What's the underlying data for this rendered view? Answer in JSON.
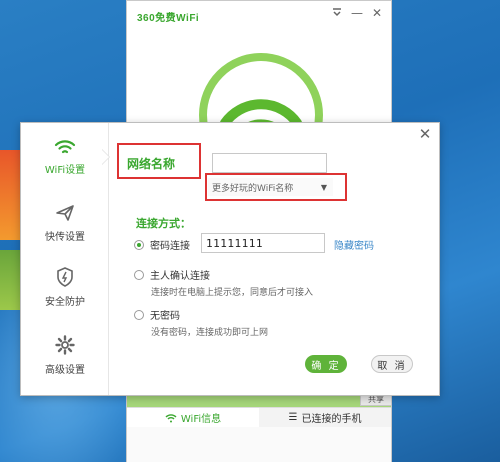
{
  "main_window": {
    "title": "360免费WiFi",
    "tabs": [
      {
        "label": "WiFi信息",
        "icon": "wifi-icon"
      },
      {
        "label": "已连接的手机",
        "icon": "list-icon"
      }
    ],
    "behind_button": "共享"
  },
  "dialog": {
    "sidebar": [
      {
        "label": "WiFi设置",
        "icon": "wifi-icon"
      },
      {
        "label": "快传设置",
        "icon": "send-icon"
      },
      {
        "label": "安全防护",
        "icon": "shield-icon"
      },
      {
        "label": "高级设置",
        "icon": "gear-icon"
      }
    ],
    "network_name_label": "网络名称",
    "network_name_value": "",
    "more_names_label": "更多好玩的WiFi名称",
    "connection_label": "连接方式：",
    "options": [
      {
        "label": "密码连接",
        "checked": true
      },
      {
        "label": "主人确认连接",
        "checked": false,
        "hint": "连接时在电脑上提示您，同意后才可接入"
      },
      {
        "label": "无密码",
        "checked": false,
        "hint": "没有密码，连接成功即可上网"
      }
    ],
    "password_value": "11111111",
    "hide_password_link": "隐藏密码",
    "ok_label": "确 定",
    "cancel_label": "取 消"
  },
  "colors": {
    "accent": "#3aa72f",
    "link": "#3a87c8",
    "annotation": "#dd3333"
  }
}
